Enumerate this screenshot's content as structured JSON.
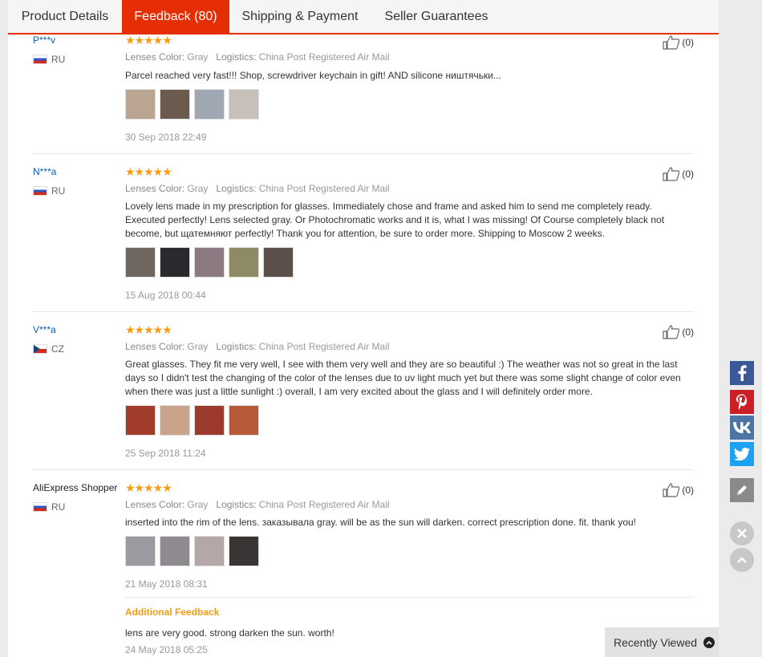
{
  "tabs": [
    {
      "label": "Product Details"
    },
    {
      "label": "Feedback (80)"
    },
    {
      "label": "Shipping & Payment"
    },
    {
      "label": "Seller Guarantees"
    }
  ],
  "common": {
    "stars": "★★★★★",
    "color_label": "Lenses Color:",
    "logistics_label": "Logistics:"
  },
  "reviews": [
    {
      "user": "P***v",
      "country": "RU",
      "flag": "ru",
      "color": "Gray",
      "logistics": "China Post Registered Air Mail",
      "text": "Parcel reached very fast!!! Shop, screwdriver keychain in gift! AND silicone ништячьки...",
      "thumb_colors": [
        "#b9a590",
        "#6b5a4d",
        "#9fa7b3",
        "#c6c0b8"
      ],
      "date": "30 Sep 2018 22:49",
      "helpful": "(0)"
    },
    {
      "user": "N***a",
      "country": "RU",
      "flag": "ru",
      "color": "Gray",
      "logistics": "China Post Registered Air Mail",
      "text": "Lovely lens made in my prescription for glasses. Immediately chose and frame and asked him to send me completely ready. Executed perfectly! Lens selected gray. Or Photochromatic works and it is, what I was missing! Of Course completely black not become, but щатемняют perfectly! Thank you for attention, be sure to order more. Shipping to Moscow 2 weeks.",
      "thumb_colors": [
        "#6f6660",
        "#2a2a2e",
        "#8c7a82",
        "#8e8a66",
        "#5c4f4a"
      ],
      "date": "15 Aug 2018 00:44",
      "helpful": "(0)"
    },
    {
      "user": "V***a",
      "country": "CZ",
      "flag": "cz",
      "color": "Gray",
      "logistics": "China Post Registered Air Mail",
      "text": "Great glasses. They fit me very well, I see with them very well and they are so beautiful :) The weather was not so great in the last days so I didn't test the changing of the color of the lenses due to uv light much yet but there was some slight change of color even when there was just a little sunlight :) overall, I am very excited about the glass and I will definitely order more.",
      "thumb_colors": [
        "#a13b2a",
        "#c9a48a",
        "#9c3a2c",
        "#b75a3a"
      ],
      "date": "25 Sep 2018 11:24",
      "helpful": "(0)"
    },
    {
      "user": "AliExpress Shopper",
      "country": "RU",
      "flag": "ru",
      "color": "Gray",
      "logistics": "China Post Registered Air Mail",
      "text": "inserted into the rim of the lens. заказывала gray. will be as the sun will darken. correct prescription done. fit. thank you!",
      "thumb_colors": [
        "#9a9aa0",
        "#8f8a90",
        "#b5a6a8",
        "#3a3434"
      ],
      "date": "21 May 2018 08:31",
      "helpful": "(0)",
      "additional": {
        "title": "Additional Feedback",
        "text": "lens are very good. strong darken the sun. worth!",
        "date": "24 May 2018 05:25"
      }
    }
  ],
  "social": [
    "facebook-icon",
    "pinterest-icon",
    "vk-icon",
    "twitter-icon"
  ],
  "recently_viewed": "Recently Viewed"
}
